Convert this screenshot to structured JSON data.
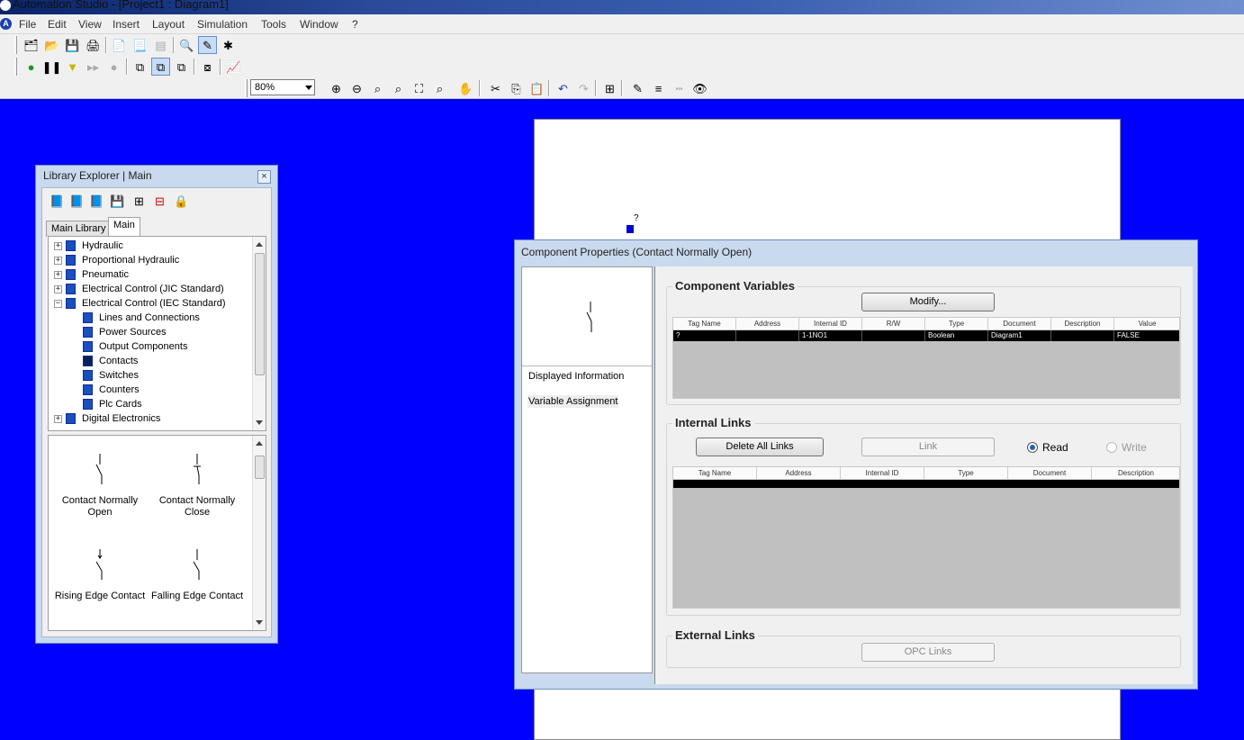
{
  "window": {
    "title": "Automation Studio - [Project1 : Diagram1]"
  },
  "menu": [
    "File",
    "Edit",
    "View",
    "Insert",
    "Layout",
    "Simulation",
    "Tools",
    "Window",
    "?"
  ],
  "toolbar": {
    "zoom": "80%"
  },
  "diagram": {
    "component_label": "?"
  },
  "library": {
    "title": "Library Explorer | Main",
    "close": "×",
    "tabs": [
      "Main Library",
      "Main"
    ],
    "tree": [
      {
        "label": "Hydraulic"
      },
      {
        "label": "Proportional Hydraulic"
      },
      {
        "label": "Pneumatic"
      },
      {
        "label": "Electrical Control (JIC Standard)"
      },
      {
        "label": "Electrical Control (IEC Standard)"
      },
      {
        "label": "Lines and Connections"
      },
      {
        "label": "Power Sources"
      },
      {
        "label": "Output Components"
      },
      {
        "label": "Contacts"
      },
      {
        "label": "Switches"
      },
      {
        "label": "Counters"
      },
      {
        "label": "Plc Cards"
      },
      {
        "label": "Digital Electronics"
      }
    ],
    "preview": [
      {
        "label": "Contact Normally Open"
      },
      {
        "label": "Contact Normally Close"
      },
      {
        "label": "Rising Edge Contact"
      },
      {
        "label": "Falling Edge Contact"
      }
    ]
  },
  "props": {
    "title": "Component Properties (Contact Normally Open)",
    "nav": [
      "Displayed Information",
      "Variable Assignment"
    ],
    "component_variables": {
      "title": "Component Variables",
      "modify": "Modify...",
      "columns": [
        "Tag Name",
        "Address",
        "Internal ID",
        "R/W",
        "Type",
        "Document",
        "Description",
        "Value"
      ],
      "row": [
        "?",
        "",
        "1-1NO1",
        "",
        "Boolean",
        "Diagram1",
        "",
        "FALSE"
      ]
    },
    "internal_links": {
      "title": "Internal Links",
      "delete_all": "Delete All Links",
      "link": "Link",
      "read": "Read",
      "write": "Write",
      "columns": [
        "Tag Name",
        "Address",
        "Internal ID",
        "Type",
        "Document",
        "Description"
      ]
    },
    "external_links": {
      "title": "External Links",
      "opc": "OPC Links"
    }
  }
}
